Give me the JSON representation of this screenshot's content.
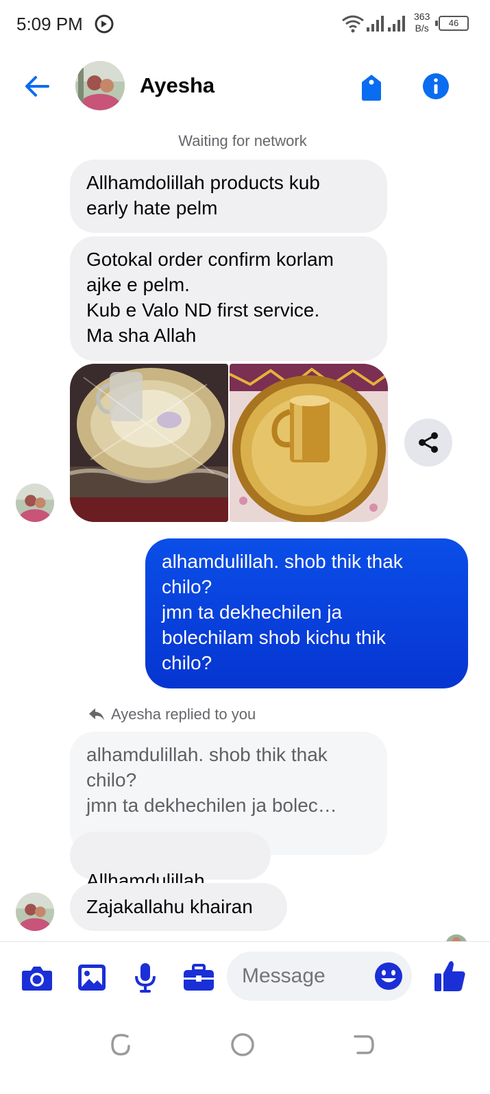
{
  "status_bar": {
    "time": "5:09 PM",
    "net_speed_value": "363",
    "net_speed_unit": "B/s",
    "battery": "46"
  },
  "header": {
    "contact_name": "Ayesha",
    "icons": [
      "back-arrow-icon",
      "tag-icon",
      "info-icon"
    ]
  },
  "conversation": {
    "network_status": "Waiting for network",
    "messages": [
      {
        "sender": "Ayesha",
        "text": "Allhamdolillah products kub\nearly hate pelm"
      },
      {
        "sender": "Ayesha",
        "text": "Gotokal order confirm korlam\najke e pelm.\nKub e Valo ND first service.\nMa sha Allah"
      },
      {
        "sender": "Ayesha",
        "type": "photos",
        "photos": [
          "brass-plate-glass-wrapped-photo",
          "brass-plate-glass-photo"
        ]
      },
      {
        "sender": "me",
        "text": "alhamdulillah. shob thik thak\nchilo?\njmn ta dekhechilen ja\nbolechilam shob kichu thik\nchilo?"
      },
      {
        "sender": "Ayesha",
        "reply_label": "Ayesha replied to you",
        "quoted_text": "alhamdulillah. shob thik thak\nchilo?\njmn ta dekhechilen ja bolec…"
      },
      {
        "sender": "Ayesha",
        "text": "Allhamdulillah",
        "emoji": "thumbs-up"
      },
      {
        "sender": "Ayesha",
        "text": "Zajakallahu khairan"
      }
    ]
  },
  "composer": {
    "placeholder": "Message",
    "tools": [
      "camera-icon",
      "gallery-icon",
      "microphone-icon",
      "briefcase-icon"
    ]
  },
  "colors": {
    "accent": "#0a5cf0",
    "outgoing_bubble": "#0a3fe0",
    "incoming_bubble": "#f0f0f3",
    "icon_blue": "#1b2fd6"
  }
}
